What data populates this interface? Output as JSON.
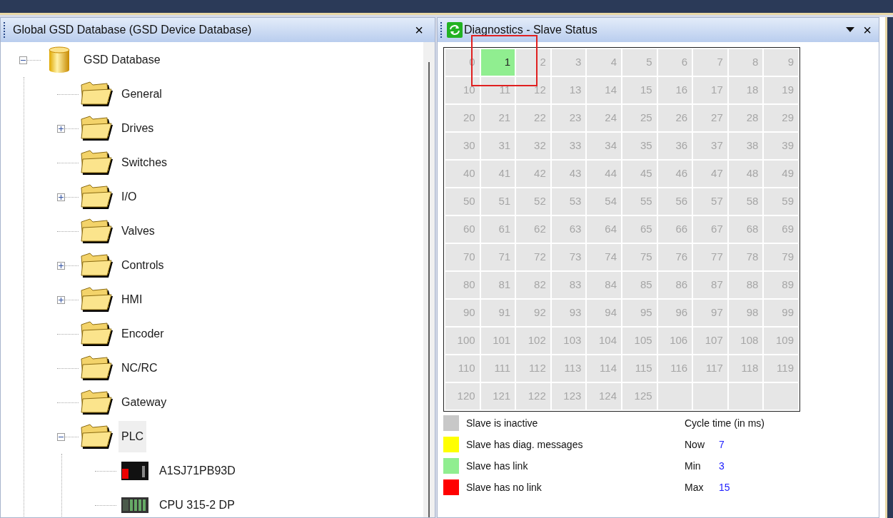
{
  "left_panel": {
    "title": "Global GSD Database (GSD Device Database)",
    "close": "×"
  },
  "tree": [
    {
      "label": "GSD Database",
      "kind": "database",
      "expanded": true,
      "selected": false,
      "children": [
        {
          "label": "General",
          "kind": "folder",
          "selected": false
        },
        {
          "label": "Drives",
          "kind": "folder",
          "expanded": false,
          "selected": false
        },
        {
          "label": "Switches",
          "kind": "folder",
          "selected": false
        },
        {
          "label": "I/O",
          "kind": "folder",
          "expanded": false,
          "selected": false
        },
        {
          "label": "Valves",
          "kind": "folder",
          "selected": false
        },
        {
          "label": "Controls",
          "kind": "folder",
          "expanded": false,
          "selected": false
        },
        {
          "label": "HMI",
          "kind": "folder",
          "expanded": false,
          "selected": false
        },
        {
          "label": "Encoder",
          "kind": "folder",
          "selected": false
        },
        {
          "label": "NC/RC",
          "kind": "folder",
          "selected": false
        },
        {
          "label": "Gateway",
          "kind": "folder",
          "selected": false
        },
        {
          "label": "PLC",
          "kind": "folder",
          "expanded": true,
          "selected": true,
          "children": [
            {
              "label": "A1SJ71PB93D",
              "kind": "module-red",
              "selected": false
            },
            {
              "label": "CPU 315-2 DP",
              "kind": "module-rack",
              "selected": false
            }
          ]
        }
      ]
    }
  ],
  "right_panel": {
    "title": "Diagnostics - Slave Status",
    "close": "×"
  },
  "slaves": [
    {
      "number": "0",
      "has_link": false
    },
    {
      "number": "1",
      "has_link": true
    },
    {
      "number": "2",
      "has_link": false
    },
    {
      "number": "3",
      "has_link": false
    },
    {
      "number": "4",
      "has_link": false
    },
    {
      "number": "5",
      "has_link": false
    },
    {
      "number": "6",
      "has_link": false
    },
    {
      "number": "7",
      "has_link": false
    },
    {
      "number": "8",
      "has_link": false
    },
    {
      "number": "9",
      "has_link": false
    },
    {
      "number": "10",
      "has_link": false
    },
    {
      "number": "11",
      "has_link": false
    },
    {
      "number": "12",
      "has_link": false
    },
    {
      "number": "13",
      "has_link": false
    },
    {
      "number": "14",
      "has_link": false
    },
    {
      "number": "15",
      "has_link": false
    },
    {
      "number": "16",
      "has_link": false
    },
    {
      "number": "17",
      "has_link": false
    },
    {
      "number": "18",
      "has_link": false
    },
    {
      "number": "19",
      "has_link": false
    },
    {
      "number": "20",
      "has_link": false
    },
    {
      "number": "21",
      "has_link": false
    },
    {
      "number": "22",
      "has_link": false
    },
    {
      "number": "23",
      "has_link": false
    },
    {
      "number": "24",
      "has_link": false
    },
    {
      "number": "25",
      "has_link": false
    },
    {
      "number": "26",
      "has_link": false
    },
    {
      "number": "27",
      "has_link": false
    },
    {
      "number": "28",
      "has_link": false
    },
    {
      "number": "29",
      "has_link": false
    },
    {
      "number": "30",
      "has_link": false
    },
    {
      "number": "31",
      "has_link": false
    },
    {
      "number": "32",
      "has_link": false
    },
    {
      "number": "33",
      "has_link": false
    },
    {
      "number": "34",
      "has_link": false
    },
    {
      "number": "35",
      "has_link": false
    },
    {
      "number": "36",
      "has_link": false
    },
    {
      "number": "37",
      "has_link": false
    },
    {
      "number": "38",
      "has_link": false
    },
    {
      "number": "39",
      "has_link": false
    },
    {
      "number": "40",
      "has_link": false
    },
    {
      "number": "41",
      "has_link": false
    },
    {
      "number": "42",
      "has_link": false
    },
    {
      "number": "43",
      "has_link": false
    },
    {
      "number": "44",
      "has_link": false
    },
    {
      "number": "45",
      "has_link": false
    },
    {
      "number": "46",
      "has_link": false
    },
    {
      "number": "47",
      "has_link": false
    },
    {
      "number": "48",
      "has_link": false
    },
    {
      "number": "49",
      "has_link": false
    },
    {
      "number": "50",
      "has_link": false
    },
    {
      "number": "51",
      "has_link": false
    },
    {
      "number": "52",
      "has_link": false
    },
    {
      "number": "53",
      "has_link": false
    },
    {
      "number": "54",
      "has_link": false
    },
    {
      "number": "55",
      "has_link": false
    },
    {
      "number": "56",
      "has_link": false
    },
    {
      "number": "57",
      "has_link": false
    },
    {
      "number": "58",
      "has_link": false
    },
    {
      "number": "59",
      "has_link": false
    },
    {
      "number": "60",
      "has_link": false
    },
    {
      "number": "61",
      "has_link": false
    },
    {
      "number": "62",
      "has_link": false
    },
    {
      "number": "63",
      "has_link": false
    },
    {
      "number": "64",
      "has_link": false
    },
    {
      "number": "65",
      "has_link": false
    },
    {
      "number": "66",
      "has_link": false
    },
    {
      "number": "67",
      "has_link": false
    },
    {
      "number": "68",
      "has_link": false
    },
    {
      "number": "69",
      "has_link": false
    },
    {
      "number": "70",
      "has_link": false
    },
    {
      "number": "71",
      "has_link": false
    },
    {
      "number": "72",
      "has_link": false
    },
    {
      "number": "73",
      "has_link": false
    },
    {
      "number": "74",
      "has_link": false
    },
    {
      "number": "75",
      "has_link": false
    },
    {
      "number": "76",
      "has_link": false
    },
    {
      "number": "77",
      "has_link": false
    },
    {
      "number": "78",
      "has_link": false
    },
    {
      "number": "79",
      "has_link": false
    },
    {
      "number": "80",
      "has_link": false
    },
    {
      "number": "81",
      "has_link": false
    },
    {
      "number": "82",
      "has_link": false
    },
    {
      "number": "83",
      "has_link": false
    },
    {
      "number": "84",
      "has_link": false
    },
    {
      "number": "85",
      "has_link": false
    },
    {
      "number": "86",
      "has_link": false
    },
    {
      "number": "87",
      "has_link": false
    },
    {
      "number": "88",
      "has_link": false
    },
    {
      "number": "89",
      "has_link": false
    },
    {
      "number": "90",
      "has_link": false
    },
    {
      "number": "91",
      "has_link": false
    },
    {
      "number": "92",
      "has_link": false
    },
    {
      "number": "93",
      "has_link": false
    },
    {
      "number": "94",
      "has_link": false
    },
    {
      "number": "95",
      "has_link": false
    },
    {
      "number": "96",
      "has_link": false
    },
    {
      "number": "97",
      "has_link": false
    },
    {
      "number": "98",
      "has_link": false
    },
    {
      "number": "99",
      "has_link": false
    },
    {
      "number": "100",
      "has_link": false
    },
    {
      "number": "101",
      "has_link": false
    },
    {
      "number": "102",
      "has_link": false
    },
    {
      "number": "103",
      "has_link": false
    },
    {
      "number": "104",
      "has_link": false
    },
    {
      "number": "105",
      "has_link": false
    },
    {
      "number": "106",
      "has_link": false
    },
    {
      "number": "107",
      "has_link": false
    },
    {
      "number": "108",
      "has_link": false
    },
    {
      "number": "109",
      "has_link": false
    },
    {
      "number": "110",
      "has_link": false
    },
    {
      "number": "111",
      "has_link": false
    },
    {
      "number": "112",
      "has_link": false
    },
    {
      "number": "113",
      "has_link": false
    },
    {
      "number": "114",
      "has_link": false
    },
    {
      "number": "115",
      "has_link": false
    },
    {
      "number": "116",
      "has_link": false
    },
    {
      "number": "117",
      "has_link": false
    },
    {
      "number": "118",
      "has_link": false
    },
    {
      "number": "119",
      "has_link": false
    },
    {
      "number": "120",
      "has_link": false
    },
    {
      "number": "121",
      "has_link": false
    },
    {
      "number": "122",
      "has_link": false
    },
    {
      "number": "123",
      "has_link": false
    },
    {
      "number": "124",
      "has_link": false
    },
    {
      "number": "125",
      "has_link": false
    }
  ],
  "legend": [
    {
      "label": "Slave is inactive",
      "color": "#c8c8c8"
    },
    {
      "label": "Slave has diag. messages",
      "color": "#ffff00"
    },
    {
      "label": "Slave has link",
      "color": "#90ee90"
    },
    {
      "label": "Slave has no link",
      "color": "#ff0000"
    }
  ],
  "cycle_time": {
    "title": "Cycle time (in ms)",
    "rows": [
      {
        "label": "Now",
        "value": "7"
      },
      {
        "label": "Min",
        "value": "3"
      },
      {
        "label": "Max",
        "value": "15"
      }
    ]
  }
}
